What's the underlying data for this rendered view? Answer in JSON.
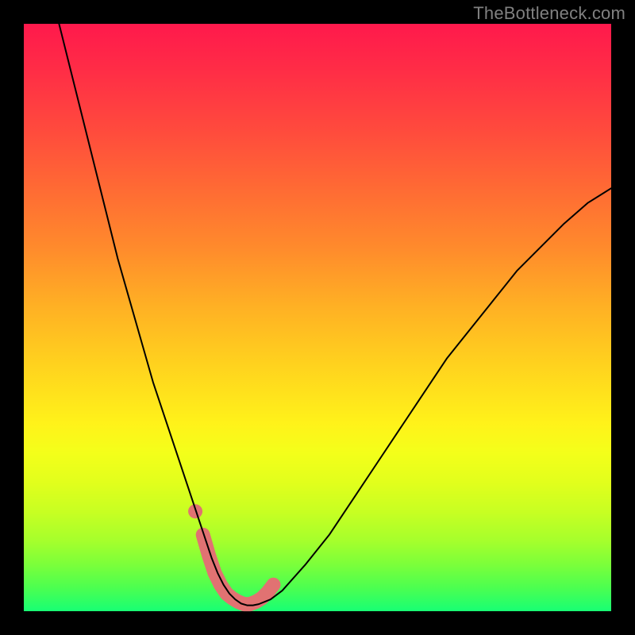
{
  "watermark": "TheBottleneck.com",
  "chart_data": {
    "type": "line",
    "title": "",
    "xlabel": "",
    "ylabel": "",
    "xlim": [
      0,
      100
    ],
    "ylim": [
      0,
      100
    ],
    "grid": false,
    "series": [
      {
        "name": "bottleneck-curve",
        "x": [
          6,
          8,
          10,
          12,
          14,
          16,
          18,
          20,
          22,
          24,
          26,
          28,
          30,
          31,
          32,
          33,
          34,
          35,
          36,
          37,
          38,
          39,
          40,
          42,
          44,
          48,
          52,
          56,
          60,
          64,
          68,
          72,
          76,
          80,
          84,
          88,
          92,
          96,
          100
        ],
        "y": [
          100,
          92,
          84,
          76,
          68,
          60,
          53,
          46,
          39,
          33,
          27,
          21,
          15,
          12,
          9,
          6.5,
          4.5,
          3,
          2,
          1.3,
          1,
          1,
          1.2,
          2,
          3.5,
          8,
          13,
          19,
          25,
          31,
          37,
          43,
          48,
          53,
          58,
          62,
          66,
          69.5,
          72
        ],
        "color": "#000000",
        "stroke_width": 2
      },
      {
        "name": "highlight-band",
        "x": [
          30.5,
          31.5,
          32.5,
          33.5,
          34.5,
          35.5,
          36.5,
          37.5,
          38.5,
          39.5,
          40.5,
          41.5,
          42.5
        ],
        "y": [
          13,
          9.5,
          6.5,
          4.5,
          3,
          2.2,
          1.6,
          1.2,
          1.2,
          1.6,
          2.2,
          3.2,
          4.5
        ],
        "color": "#e17272",
        "stroke_width": 18
      }
    ],
    "markers": [
      {
        "name": "dot",
        "x": 29.2,
        "y": 17,
        "r": 9,
        "color": "#e17272"
      }
    ]
  }
}
